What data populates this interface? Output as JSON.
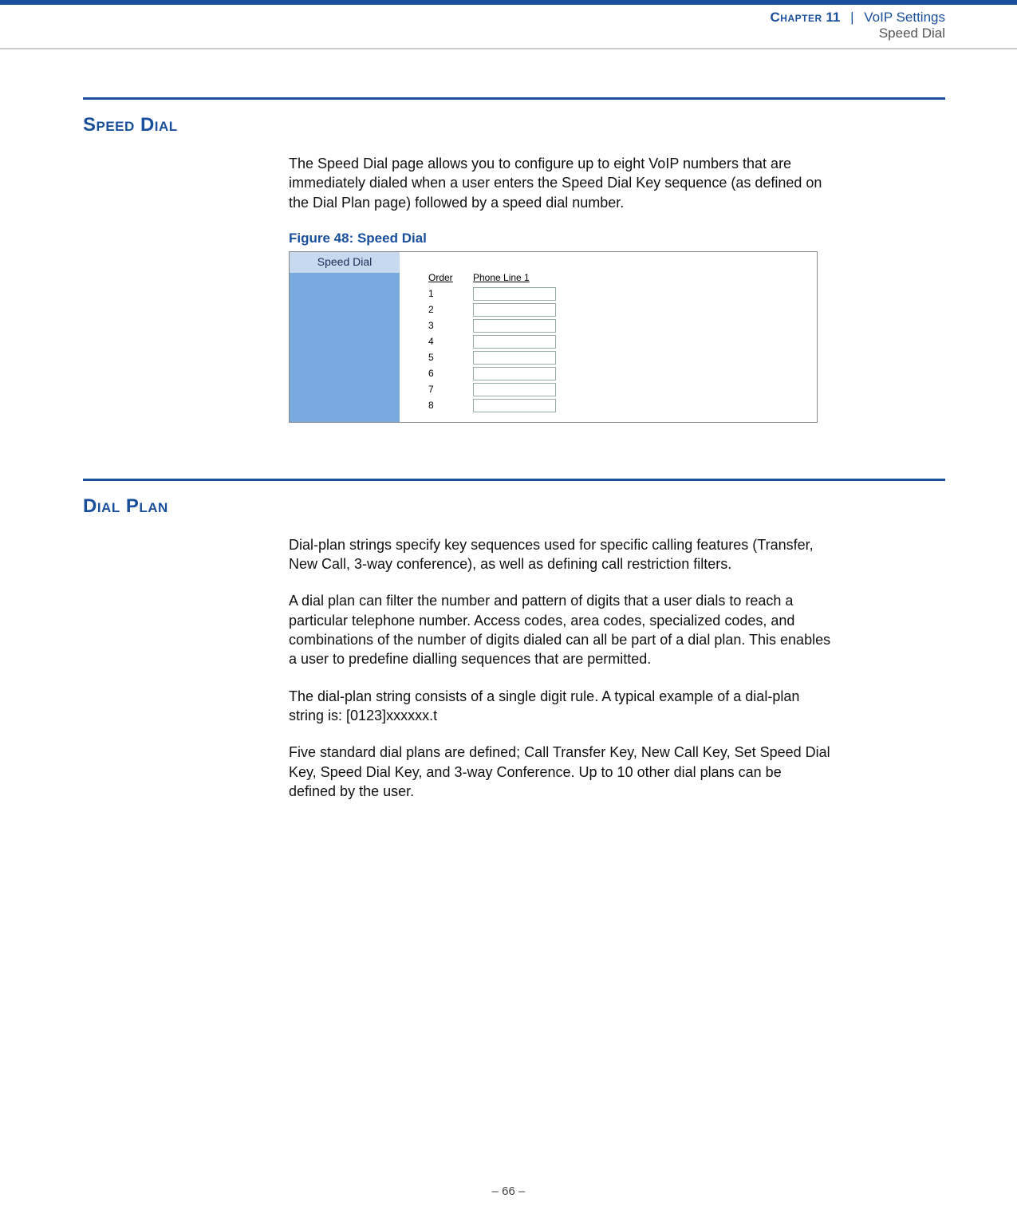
{
  "header": {
    "chapter_label": "Chapter",
    "chapter_number": "11",
    "separator": "|",
    "book_part": "VoIP Settings",
    "page_topic": "Speed Dial"
  },
  "section1": {
    "heading": "Speed Dial",
    "intro": "The Speed Dial page allows you to configure up to eight VoIP numbers that are immediately dialed when a user enters the Speed Dial Key sequence (as defined on the Dial Plan page) followed by a speed dial number.",
    "figure_caption": "Figure 48:  Speed Dial",
    "figure": {
      "tab_label": "Speed Dial",
      "col_order": "Order",
      "col_phone": "Phone Line 1",
      "rows": [
        "1",
        "2",
        "3",
        "4",
        "5",
        "6",
        "7",
        "8"
      ]
    }
  },
  "section2": {
    "heading": "Dial Plan",
    "p1": "Dial-plan strings specify key sequences used for specific calling features (Transfer, New Call, 3-way conference), as well as defining call restriction filters.",
    "p2": "A dial plan can filter the number and pattern of digits that a user dials to reach a particular telephone number. Access codes, area codes, specialized codes, and combinations of the number of digits dialed can all be part of a dial plan. This enables a user to predefine dialling sequences that are permitted.",
    "p3": "The dial-plan string consists of a single digit rule. A typical example of a dial-plan string is: [0123]xxxxxx.t",
    "p4": "Five standard dial plans are defined; Call Transfer Key, New Call Key, Set Speed Dial Key, Speed Dial Key, and 3-way Conference. Up to 10 other dial plans can be defined by the user."
  },
  "footer": {
    "page_number": "–  66  –"
  }
}
